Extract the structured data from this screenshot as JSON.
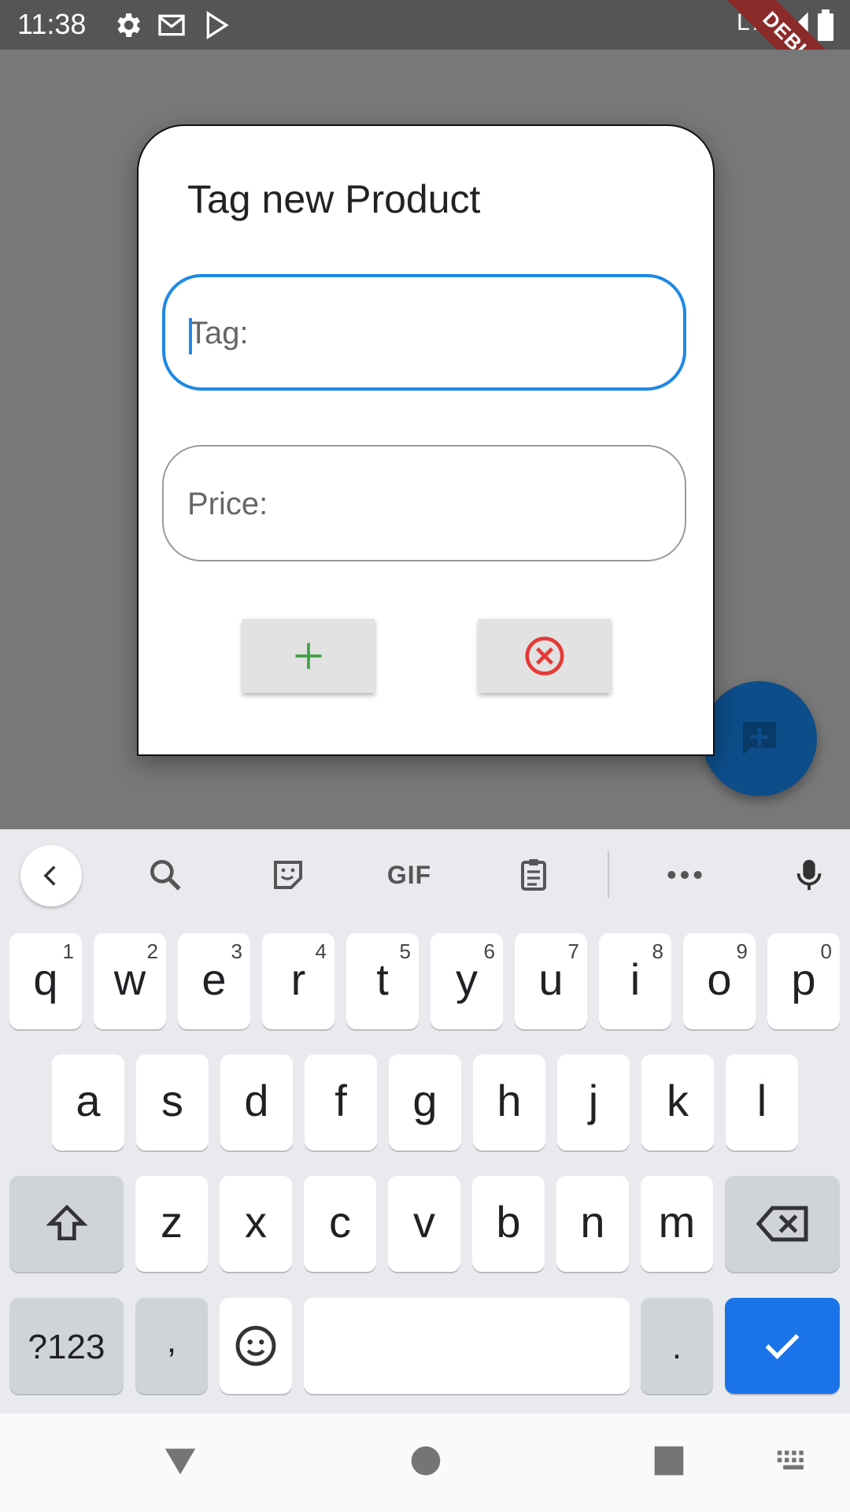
{
  "status_bar": {
    "time": "11:38",
    "icons": [
      "settings-icon",
      "gmail-icon",
      "play-store-icon"
    ],
    "network": "LTE",
    "debug_banner": "DEBUG"
  },
  "dialog": {
    "title": "Tag new Product",
    "tag_field": {
      "placeholder": "Tag:",
      "value": ""
    },
    "price_field": {
      "placeholder": "Price:",
      "value": ""
    },
    "add_button_icon": "plus-icon",
    "cancel_button_icon": "cancel-circle-icon"
  },
  "fab": {
    "icon": "add-comment-icon"
  },
  "keyboard": {
    "toolbar": [
      "back-icon",
      "search-icon",
      "sticker-icon",
      "GIF",
      "clipboard-icon",
      "more-icon",
      "mic-icon"
    ],
    "gif_label": "GIF",
    "row1": [
      {
        "ch": "q",
        "num": "1"
      },
      {
        "ch": "w",
        "num": "2"
      },
      {
        "ch": "e",
        "num": "3"
      },
      {
        "ch": "r",
        "num": "4"
      },
      {
        "ch": "t",
        "num": "5"
      },
      {
        "ch": "y",
        "num": "6"
      },
      {
        "ch": "u",
        "num": "7"
      },
      {
        "ch": "i",
        "num": "8"
      },
      {
        "ch": "o",
        "num": "9"
      },
      {
        "ch": "p",
        "num": "0"
      }
    ],
    "row2": [
      "a",
      "s",
      "d",
      "f",
      "g",
      "h",
      "j",
      "k",
      "l"
    ],
    "row3": [
      "z",
      "x",
      "c",
      "v",
      "b",
      "n",
      "m"
    ],
    "symbols_label": "?123",
    "comma": ",",
    "period": "."
  },
  "colors": {
    "accent_blue": "#1e88e5",
    "add_green": "#43a047",
    "cancel_red": "#e53935",
    "fab_blue": "#0d4d8a"
  }
}
